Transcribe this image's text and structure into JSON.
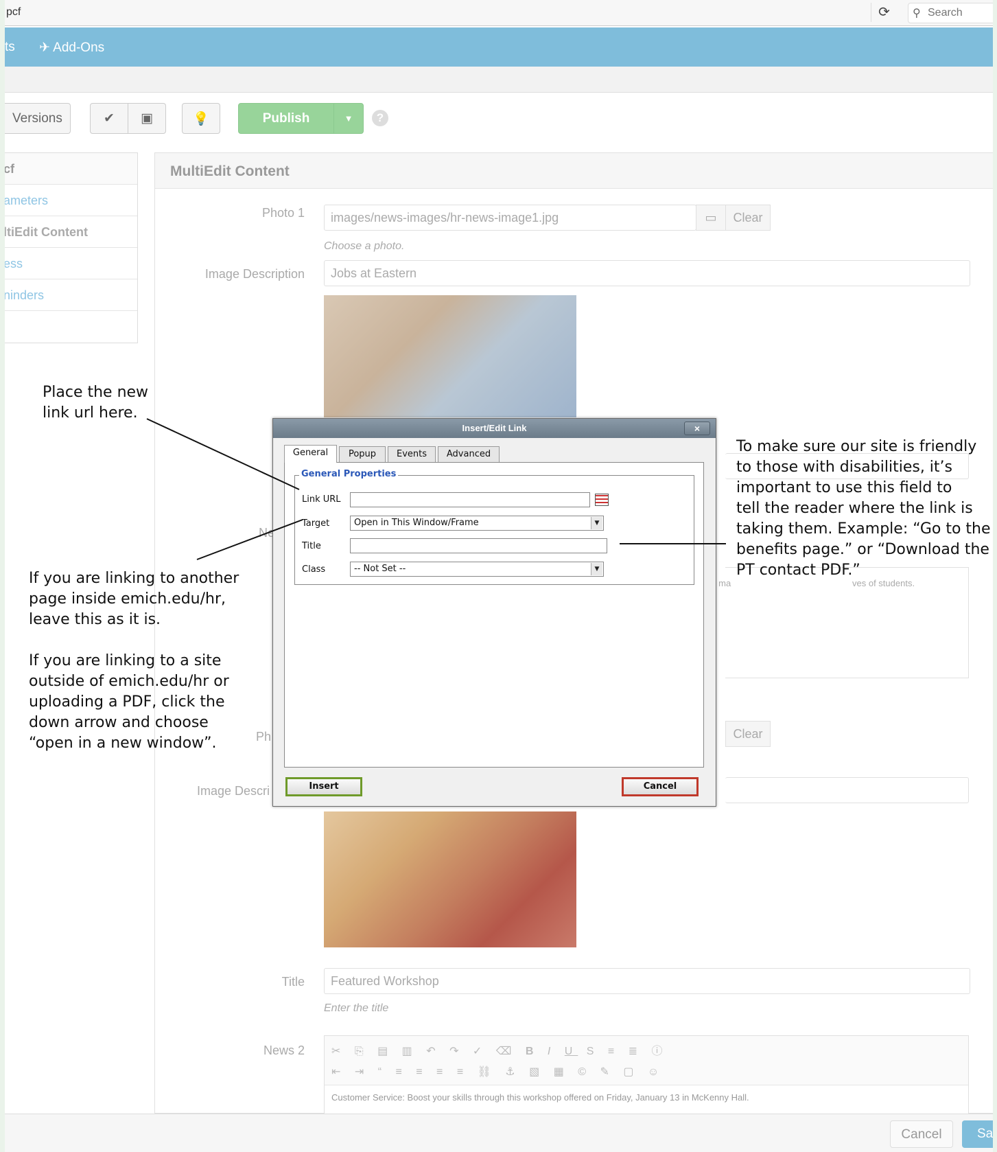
{
  "browser": {
    "url": "pcf",
    "reload_icon": "reload-icon",
    "search_placeholder": "Search"
  },
  "nav": {
    "partial_item": "ts",
    "addons_label": "Add-Ons"
  },
  "toolbar": {
    "versions_label": "Versions",
    "publish_label": "Publish"
  },
  "sidebar": {
    "items": [
      {
        "label": "cf"
      },
      {
        "label": "ameters"
      },
      {
        "label": "ltiEdit Content"
      },
      {
        "label": "ess"
      },
      {
        "label": "ninders"
      }
    ]
  },
  "main": {
    "title": "MultiEdit Content",
    "photo1": {
      "label": "Photo 1",
      "value": "images/news-images/hr-news-image1.jpg",
      "clear_label": "Clear",
      "help": "Choose a photo."
    },
    "image_description": {
      "label": "Image Description",
      "value": "Jobs at Eastern"
    },
    "news_label_partial": "Ne",
    "news_snippet_partial": "s ma",
    "news_snippet_tail": "ves of students.",
    "photo2": {
      "label_partial": "Ph",
      "clear_label": "Clear"
    },
    "image_description2_partial": "Image Descri",
    "title_field": {
      "label": "Title",
      "value": "Featured Workshop",
      "help": "Enter the title"
    },
    "news2": {
      "label": "News 2",
      "body": "Customer Service: Boost your skills through this workshop offered on Friday, January 13 in McKenny Hall."
    },
    "footer": {
      "cancel_label": "Cancel",
      "save_partial": "Sa"
    }
  },
  "modal": {
    "title": "Insert/Edit Link",
    "close_label": "×",
    "tabs": [
      "General",
      "Popup",
      "Events",
      "Advanced"
    ],
    "legend": "General Properties",
    "link_url_label": "Link URL",
    "link_url_value": "",
    "target_label": "Target",
    "target_value": "Open in This Window/Frame",
    "title_label": "Title",
    "title_value": "",
    "class_label": "Class",
    "class_value": "-- Not Set --",
    "insert_label": "Insert",
    "cancel_label": "Cancel"
  },
  "annotations": {
    "link_url": [
      "Place the new",
      "link url here."
    ],
    "target": [
      "If you are linking to another",
      "page inside emich.edu/hr,",
      "leave this as it is.",
      "",
      "If you are linking to a site",
      "outside of emich.edu/hr or",
      "uploading a PDF, click the",
      "down arrow and choose",
      "“open in a new window”."
    ],
    "title": [
      "To make sure our site is friendly",
      "to those with disabilities, it’s",
      "important to use this field to",
      "tell the reader where the link is",
      "taking them. Example: “Go to the",
      "benefits page.” or “Download the",
      "PT contact PDF.”"
    ]
  }
}
